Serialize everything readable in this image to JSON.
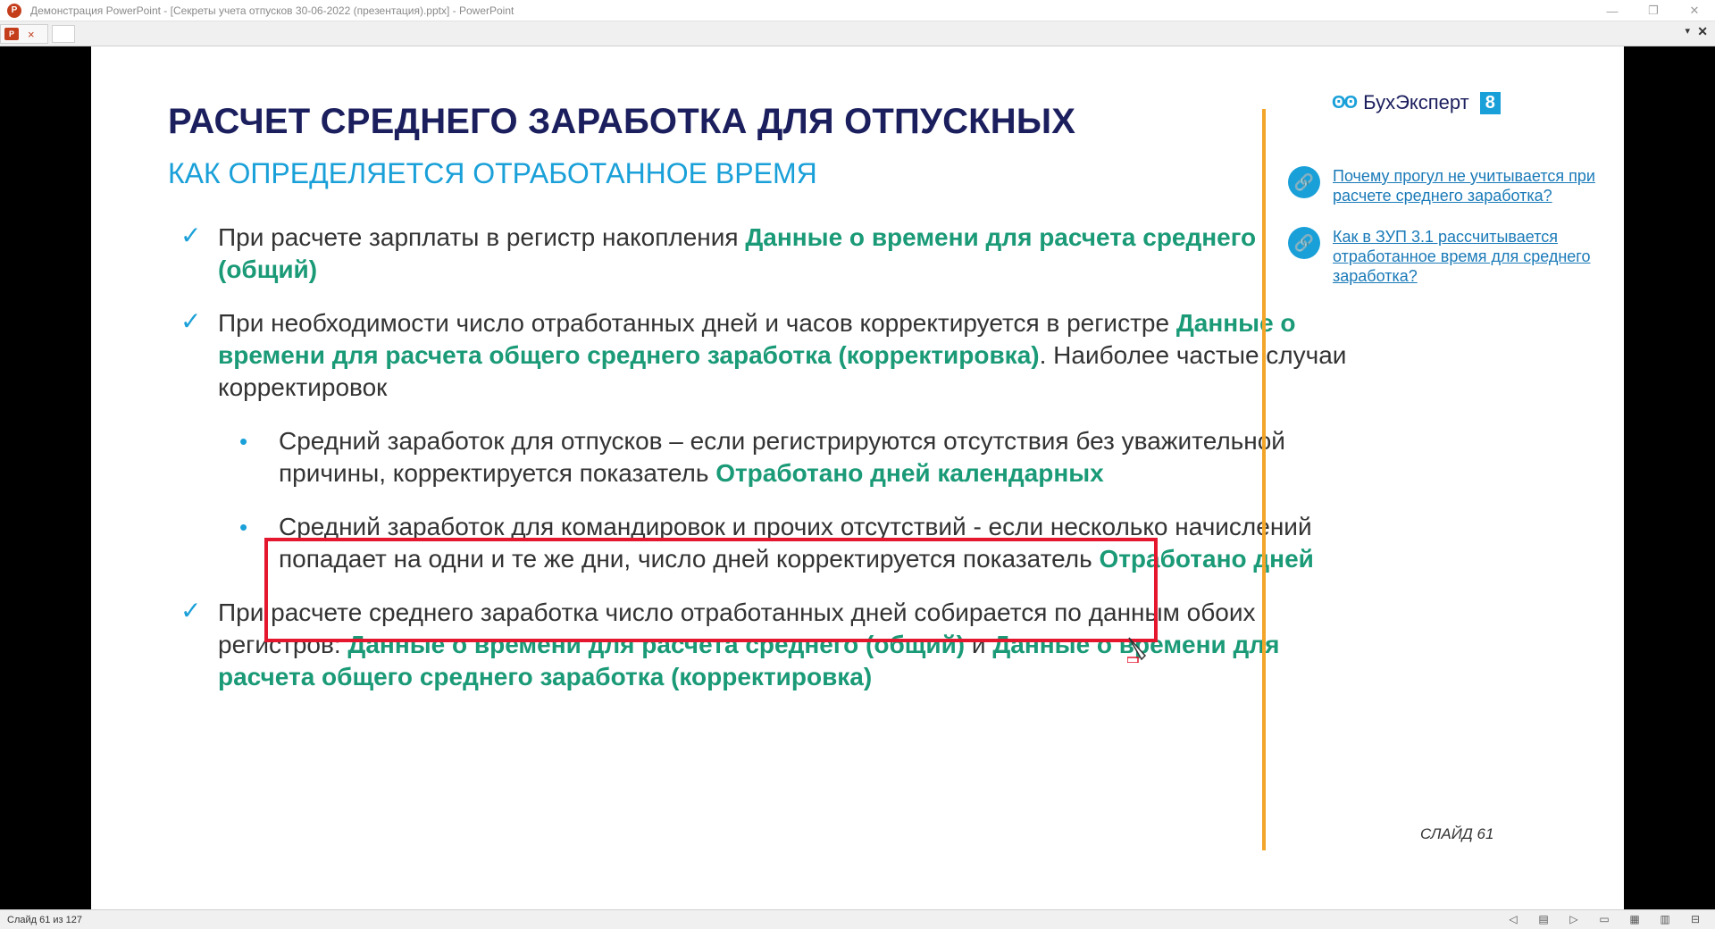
{
  "window": {
    "title": "Демонстрация PowerPoint - [Секреты учета отпусков 30-06-2022 (презентация).pptx] - PowerPoint",
    "app_icon": "P"
  },
  "tabs": {
    "close_icon": "×",
    "dropdown_icon": "▾",
    "close_all_icon": "✕"
  },
  "slide": {
    "title": "РАСЧЕТ СРЕДНЕГО ЗАРАБОТКА ДЛЯ ОТПУСКНЫХ",
    "subtitle": "КАК ОПРЕДЕЛЯЕТСЯ ОТРАБОТАННОЕ ВРЕМЯ",
    "items": [
      {
        "marker": "check",
        "text1": "При расчете зарплаты в регистр накопления ",
        "hl1": "Данные о времени для расчета среднего (общий)"
      },
      {
        "marker": "check",
        "text1": "При необходимости число отработанных дней и часов корректируется в регистре ",
        "hl1": "Данные о времени для расчета общего среднего заработка (корректировка)",
        "text2": ". Наиболее частые случаи корректировок"
      },
      {
        "marker": "bullet",
        "text1": "Средний заработок для отпусков – если регистрируются отсутствия без уважительной причины, корректируется показатель ",
        "hl1": "Отработано дней календарных"
      },
      {
        "marker": "bullet",
        "text1": "Средний заработок для командировок и прочих отсутствий - если несколько начислений попадает на одни и те же дни, число дней корректируется показатель ",
        "hl1": "Отработано дней"
      },
      {
        "marker": "check",
        "text1": "При расчете среднего заработка число отработанных дней собирается по данным обоих регистров: ",
        "hl1": "Данные о времени для расчета среднего (общий)",
        "text2": " и ",
        "hl2": "Данные о времени для расчета общего среднего заработка (корректировка)"
      }
    ],
    "logo": {
      "text": "БухЭксперт",
      "badge": "8"
    },
    "links": [
      {
        "text": "Почему прогул не учитывается при расчете среднего заработка?"
      },
      {
        "text": "Как в ЗУП 3.1 рассчитывается отработанное время для среднего заработка?"
      }
    ],
    "slide_number": "СЛАЙД 61"
  },
  "status": {
    "slide_counter": "Слайд 61 из 127"
  },
  "colors": {
    "title": "#1c1f5e",
    "subtitle": "#1aa0d8",
    "highlight": "#1a9a77",
    "box": "#e4172f",
    "accent_line": "#f3a52a",
    "link": "#1a7ab8"
  }
}
